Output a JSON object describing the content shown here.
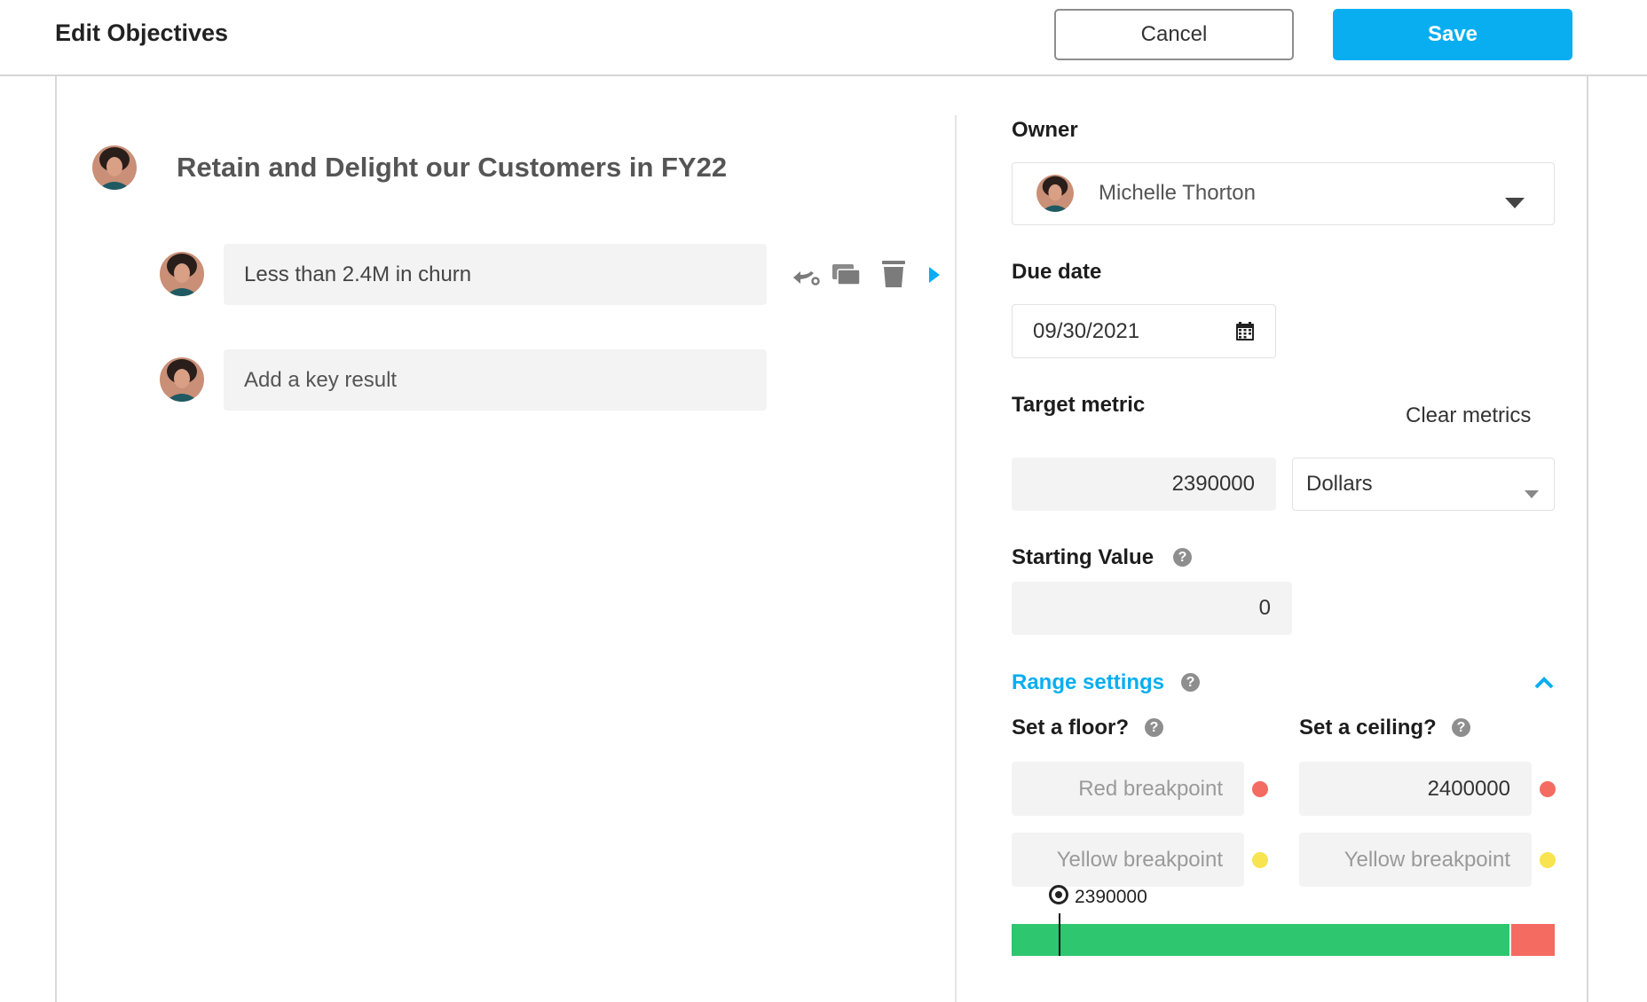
{
  "header": {
    "title": "Edit Objectives",
    "cancel_label": "Cancel",
    "save_label": "Save"
  },
  "objective": {
    "title": "Retain and Delight our Customers in FY22",
    "key_results": [
      {
        "text": "Less than 2.4M in churn"
      }
    ],
    "add_key_result_placeholder": "Add a key result",
    "kr_action_icons": [
      "align-icon",
      "duplicate-icon",
      "trash-icon",
      "expand-arrow-icon"
    ]
  },
  "panel": {
    "owner_label": "Owner",
    "owner_name": "Michelle Thorton",
    "due_date_label": "Due date",
    "due_date_value": "09/30/2021",
    "target_metric_label": "Target metric",
    "clear_metrics_label": "Clear metrics",
    "target_value": "2390000",
    "unit_value": "Dollars",
    "starting_value_label": "Starting Value",
    "starting_value": "0",
    "range_settings_label": "Range settings",
    "floor_label": "Set a floor?",
    "ceiling_label": "Set a ceiling?",
    "floor_red_placeholder": "Red breakpoint",
    "floor_yellow_placeholder": "Yellow breakpoint",
    "ceiling_red_value": "2400000",
    "ceiling_yellow_placeholder": "Yellow breakpoint",
    "range_marker_value": "2390000"
  },
  "colors": {
    "accent": "#08aef0",
    "red": "#f46b62",
    "yellow": "#f8e44e",
    "green": "#2ec66e"
  },
  "range_bar": {
    "green_fraction": 0.917,
    "red_fraction": 0.083,
    "marker_fraction": 0.087
  }
}
